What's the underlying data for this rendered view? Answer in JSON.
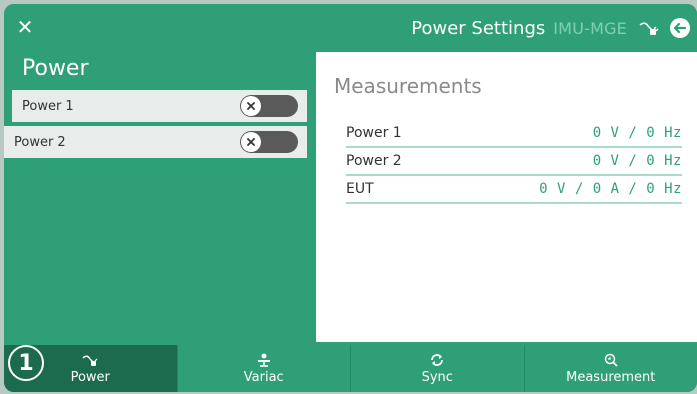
{
  "header": {
    "close_icon": "close-icon",
    "title": "Power Settings",
    "device": "IMU-MGE",
    "plug_icon": "plug-icon",
    "back_icon": "back-arrow-icon"
  },
  "left": {
    "section_title": "Power",
    "channels": [
      {
        "label": "Power 1",
        "enabled": false
      },
      {
        "label": "Power 2",
        "enabled": false
      }
    ]
  },
  "measurements": {
    "title": "Measurements",
    "rows": [
      {
        "name": "Power 1",
        "value": "0 V / 0 Hz"
      },
      {
        "name": "Power 2",
        "value": "0 V / 0 Hz"
      },
      {
        "name": "EUT",
        "value": "0 V / 0 A / 0 Hz"
      }
    ]
  },
  "nav": {
    "active": "Power",
    "tabs": [
      {
        "label": "Power",
        "icon": "plug-icon"
      },
      {
        "label": "Variac",
        "icon": "variac-icon"
      },
      {
        "label": "Sync",
        "icon": "sync-icon"
      },
      {
        "label": "Measurement",
        "icon": "measurement-icon"
      }
    ]
  },
  "callout_badge": "1",
  "colors": {
    "brand_green": "#2f9f77",
    "active_tab": "#1d6b4f",
    "value_green": "#2f9f77",
    "row_divider": "#a8dcc8",
    "toggle_off": "#5a5a5a"
  }
}
